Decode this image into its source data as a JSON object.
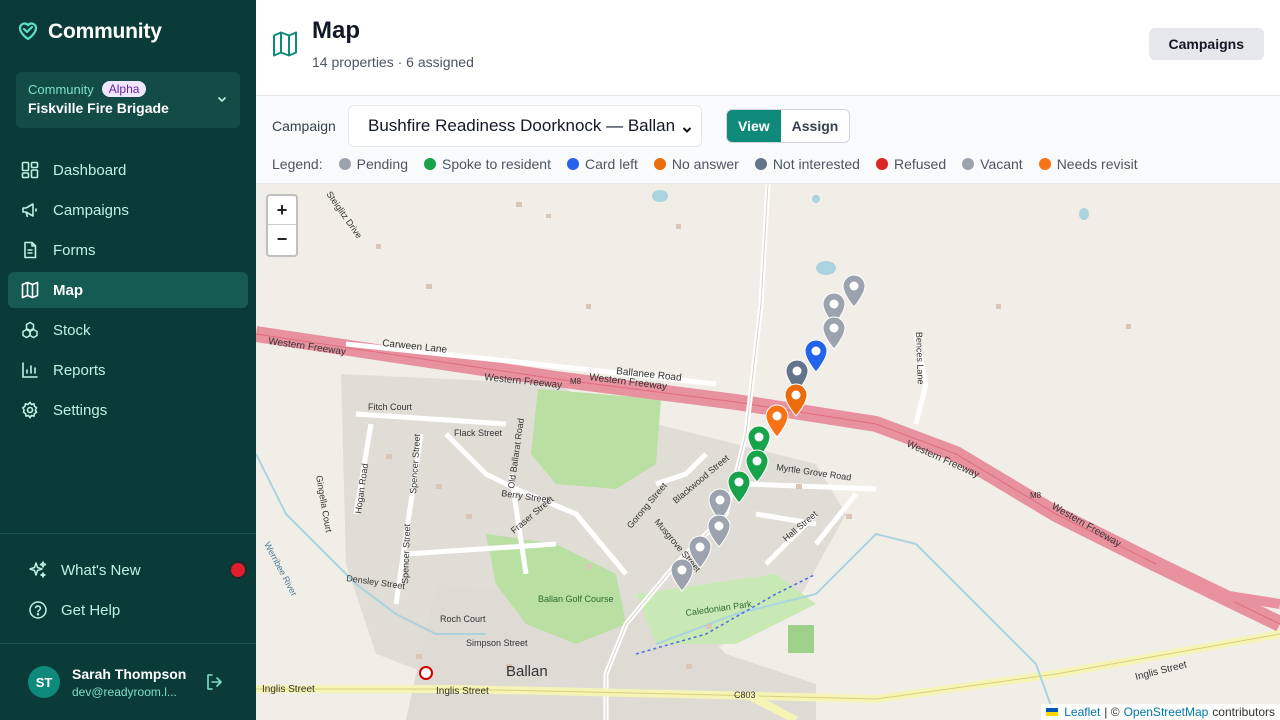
{
  "app": {
    "name": "Community"
  },
  "org": {
    "label": "Community",
    "badge": "Alpha",
    "name": "Fiskville Fire Brigade"
  },
  "nav": {
    "items": [
      {
        "label": "Dashboard",
        "icon": "dashboard-icon"
      },
      {
        "label": "Campaigns",
        "icon": "megaphone-icon"
      },
      {
        "label": "Forms",
        "icon": "document-icon"
      },
      {
        "label": "Map",
        "icon": "map-icon"
      },
      {
        "label": "Stock",
        "icon": "boxes-icon"
      },
      {
        "label": "Reports",
        "icon": "bar-chart-icon"
      },
      {
        "label": "Settings",
        "icon": "gear-icon"
      }
    ],
    "active": "Map"
  },
  "help": {
    "whats_new": "What's New",
    "get_help": "Get Help"
  },
  "user": {
    "initials": "ST",
    "name": "Sarah Thompson",
    "email": "dev@readyroom.l..."
  },
  "header": {
    "title": "Map",
    "subtitle": "14 properties · 6 assigned",
    "campaigns_button": "Campaigns"
  },
  "toolbar": {
    "campaign_label": "Campaign",
    "campaign_selected": "Bushfire Readiness Doorknock — Ballan",
    "view_label": "View",
    "assign_label": "Assign",
    "mode": "View"
  },
  "legend": {
    "title": "Legend:",
    "items": [
      {
        "label": "Pending",
        "color": "#9ca3af"
      },
      {
        "label": "Spoke to resident",
        "color": "#16a34a"
      },
      {
        "label": "Card left",
        "color": "#2563eb"
      },
      {
        "label": "No answer",
        "color": "#ea6c0a"
      },
      {
        "label": "Not interested",
        "color": "#64748b"
      },
      {
        "label": "Refused",
        "color": "#dc2626"
      },
      {
        "label": "Vacant",
        "color": "#9ca3af"
      },
      {
        "label": "Needs revisit",
        "color": "#f97316"
      }
    ]
  },
  "map": {
    "zoom_in": "+",
    "zoom_out": "−",
    "labels": {
      "western_freeway": "Western Freeway",
      "carween_lane": "Carween Lane",
      "ballanee_road": "Ballanee Road",
      "m8": "M8",
      "fitch_court": "Fitch Court",
      "flack_street": "Flack Street",
      "old_ballarat_road": "Old Ballarat Road",
      "berry_street": "Berry Street",
      "gingella_court": "Gingella Court",
      "hogan_road": "Hogan Road",
      "spencer_street": "Spencer Street",
      "densley_street": "Densley Street",
      "werribee_river": "Werribee River",
      "ballan_golf_course": "Ballan Golf Course",
      "roch_court": "Roch Court",
      "simpson_street": "Simpson Street",
      "ballan": "Ballan",
      "inglis_street": "Inglis Street",
      "c803": "C803",
      "caledonian_park": "Caledonian Park",
      "blackwood_street": "Blackwood Street",
      "myrtle_grove_road": "Myrtle Grove Road",
      "hall_street": "Hall Street",
      "gorong_street": "Gorong Street",
      "musgrove_street": "Musgrove Street",
      "bences_lane": "Bences Lane",
      "fraser_street": "Fraser Street",
      "steiglitz_drive": "Steiglitz Drive"
    },
    "attribution": {
      "leaflet": "Leaflet",
      "separator": "| ©",
      "osm": "OpenStreetMap",
      "contributors": "contributors"
    },
    "markers": [
      {
        "status": "Pending",
        "color": "#9ca3af"
      },
      {
        "status": "Pending",
        "color": "#9ca3af"
      },
      {
        "status": "Pending",
        "color": "#9ca3af"
      },
      {
        "status": "Card left",
        "color": "#2563eb"
      },
      {
        "status": "Not interested",
        "color": "#64748b"
      },
      {
        "status": "No answer",
        "color": "#ea6c0a"
      },
      {
        "status": "Needs revisit",
        "color": "#f97316"
      },
      {
        "status": "Spoke to resident",
        "color": "#16a34a"
      },
      {
        "status": "Spoke to resident",
        "color": "#16a34a"
      },
      {
        "status": "Spoke to resident",
        "color": "#16a34a"
      },
      {
        "status": "Pending",
        "color": "#9ca3af"
      },
      {
        "status": "Pending",
        "color": "#9ca3af"
      },
      {
        "status": "Pending",
        "color": "#9ca3af"
      },
      {
        "status": "Vacant",
        "color": "#9ca3af"
      }
    ]
  }
}
